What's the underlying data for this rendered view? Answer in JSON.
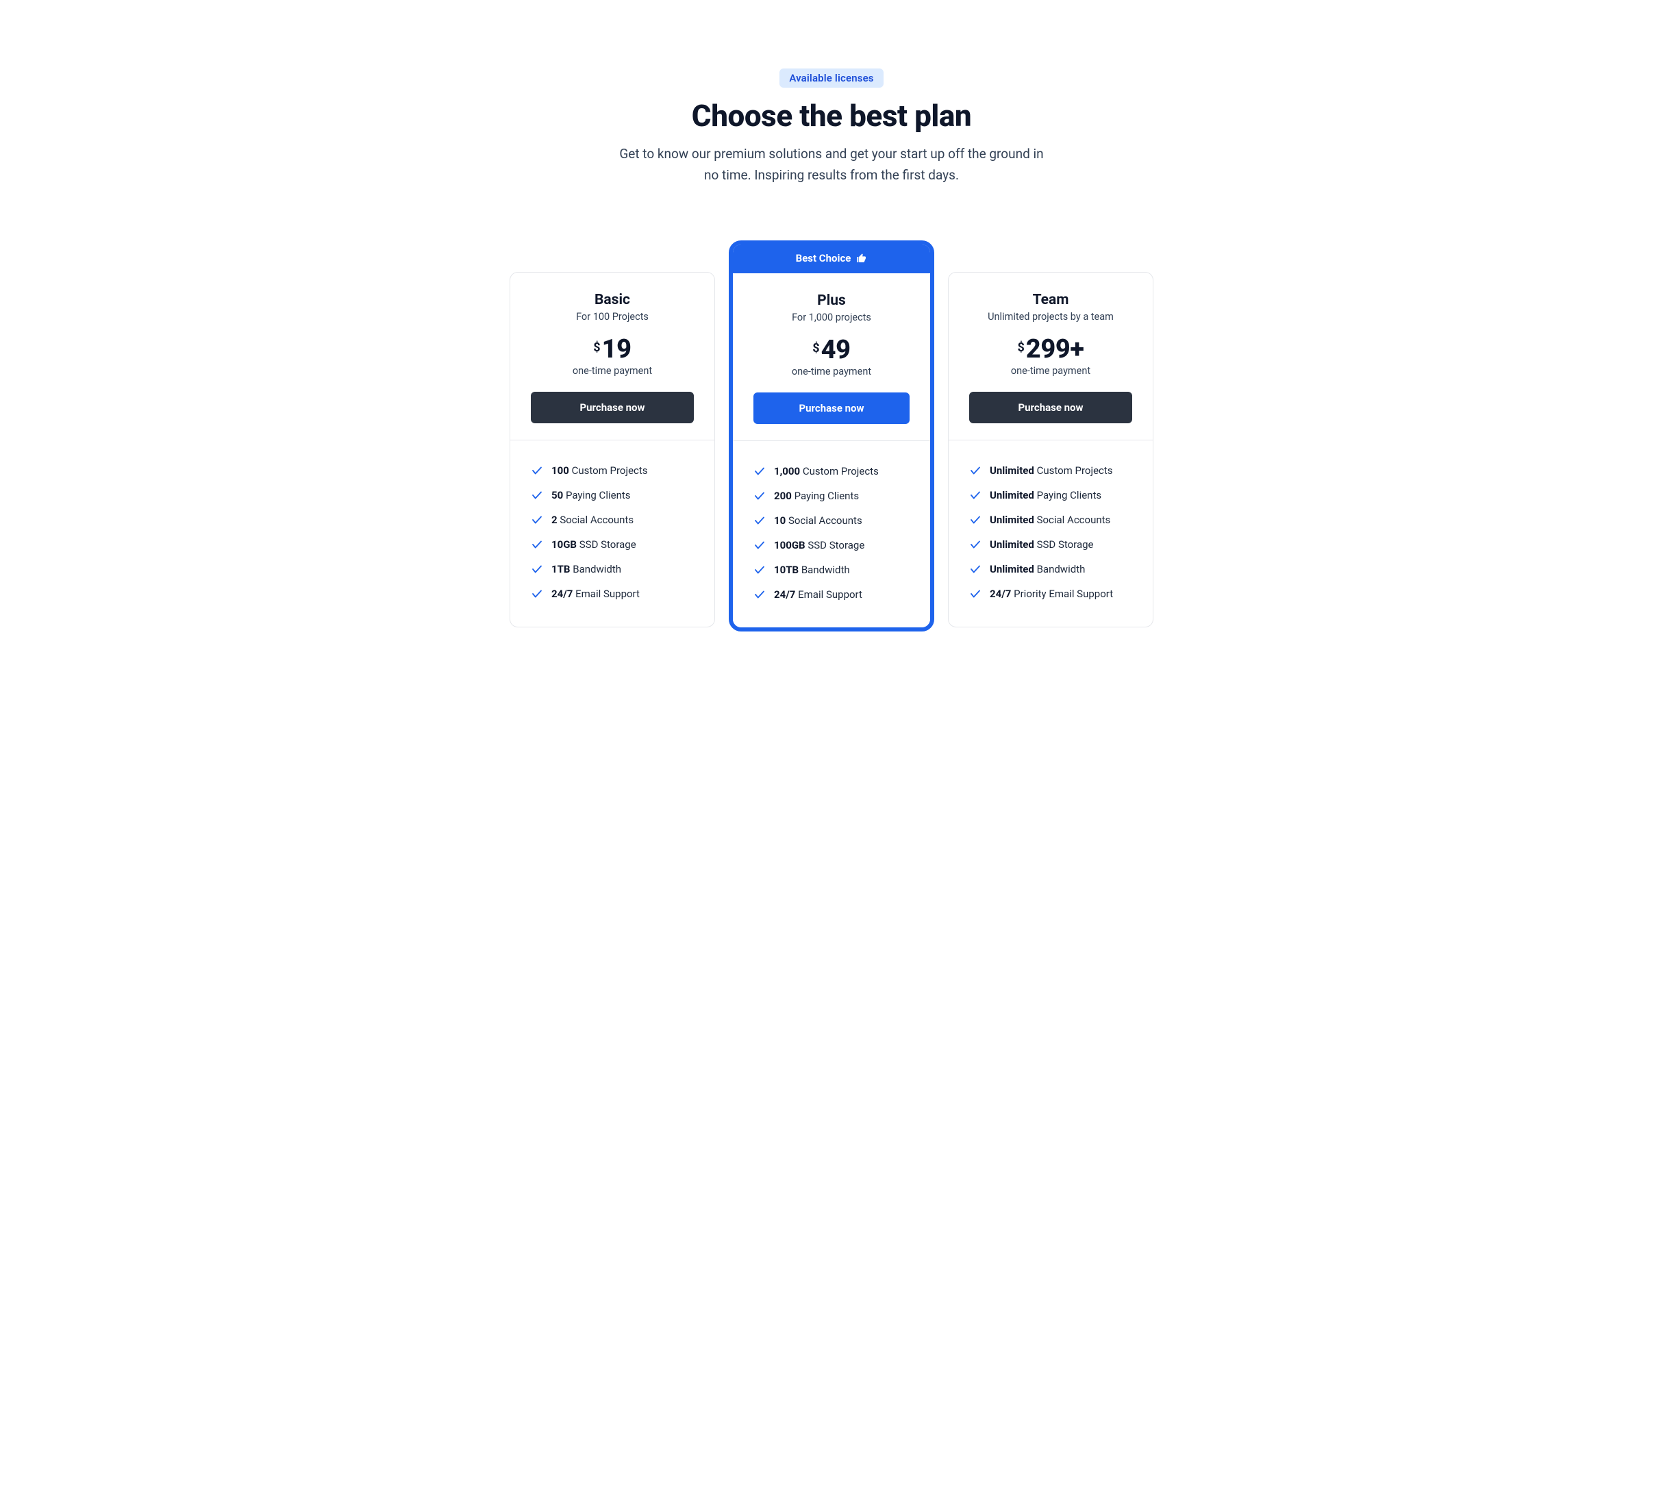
{
  "header": {
    "badge": "Available licenses",
    "title": "Choose the best plan",
    "lead": "Get to know our premium solutions and get your start up off the ground in no time. Inspiring results from the first days."
  },
  "featured_label": "Best Choice",
  "currency": "$",
  "plans": [
    {
      "id": "basic",
      "name": "Basic",
      "subtitle": "For 100 Projects",
      "price": "19",
      "price_note": "one-time payment",
      "cta": "Purchase now",
      "featured": false,
      "features": [
        {
          "bold": "100",
          "text": "Custom Projects"
        },
        {
          "bold": "50",
          "text": "Paying Clients"
        },
        {
          "bold": "2",
          "text": "Social Accounts"
        },
        {
          "bold": "10GB",
          "text": "SSD Storage"
        },
        {
          "bold": "1TB",
          "text": "Bandwidth"
        },
        {
          "bold": "24/7",
          "text": "Email Support"
        }
      ]
    },
    {
      "id": "plus",
      "name": "Plus",
      "subtitle": "For 1,000 projects",
      "price": "49",
      "price_note": "one-time payment",
      "cta": "Purchase now",
      "featured": true,
      "features": [
        {
          "bold": "1,000",
          "text": "Custom Projects"
        },
        {
          "bold": "200",
          "text": "Paying Clients"
        },
        {
          "bold": "10",
          "text": "Social Accounts"
        },
        {
          "bold": "100GB",
          "text": "SSD Storage"
        },
        {
          "bold": "10TB",
          "text": "Bandwidth"
        },
        {
          "bold": "24/7",
          "text": "Email Support"
        }
      ]
    },
    {
      "id": "team",
      "name": "Team",
      "subtitle": "Unlimited projects by a team",
      "price": "299+",
      "price_note": "one-time payment",
      "cta": "Purchase now",
      "featured": false,
      "features": [
        {
          "bold": "Unlimited",
          "text": "Custom Projects"
        },
        {
          "bold": "Unlimited",
          "text": "Paying Clients"
        },
        {
          "bold": "Unlimited",
          "text": "Social Accounts"
        },
        {
          "bold": "Unlimited",
          "text": "SSD Storage"
        },
        {
          "bold": "Unlimited",
          "text": "Bandwidth"
        },
        {
          "bold": "24/7",
          "text": "Priority Email Support"
        }
      ]
    }
  ]
}
